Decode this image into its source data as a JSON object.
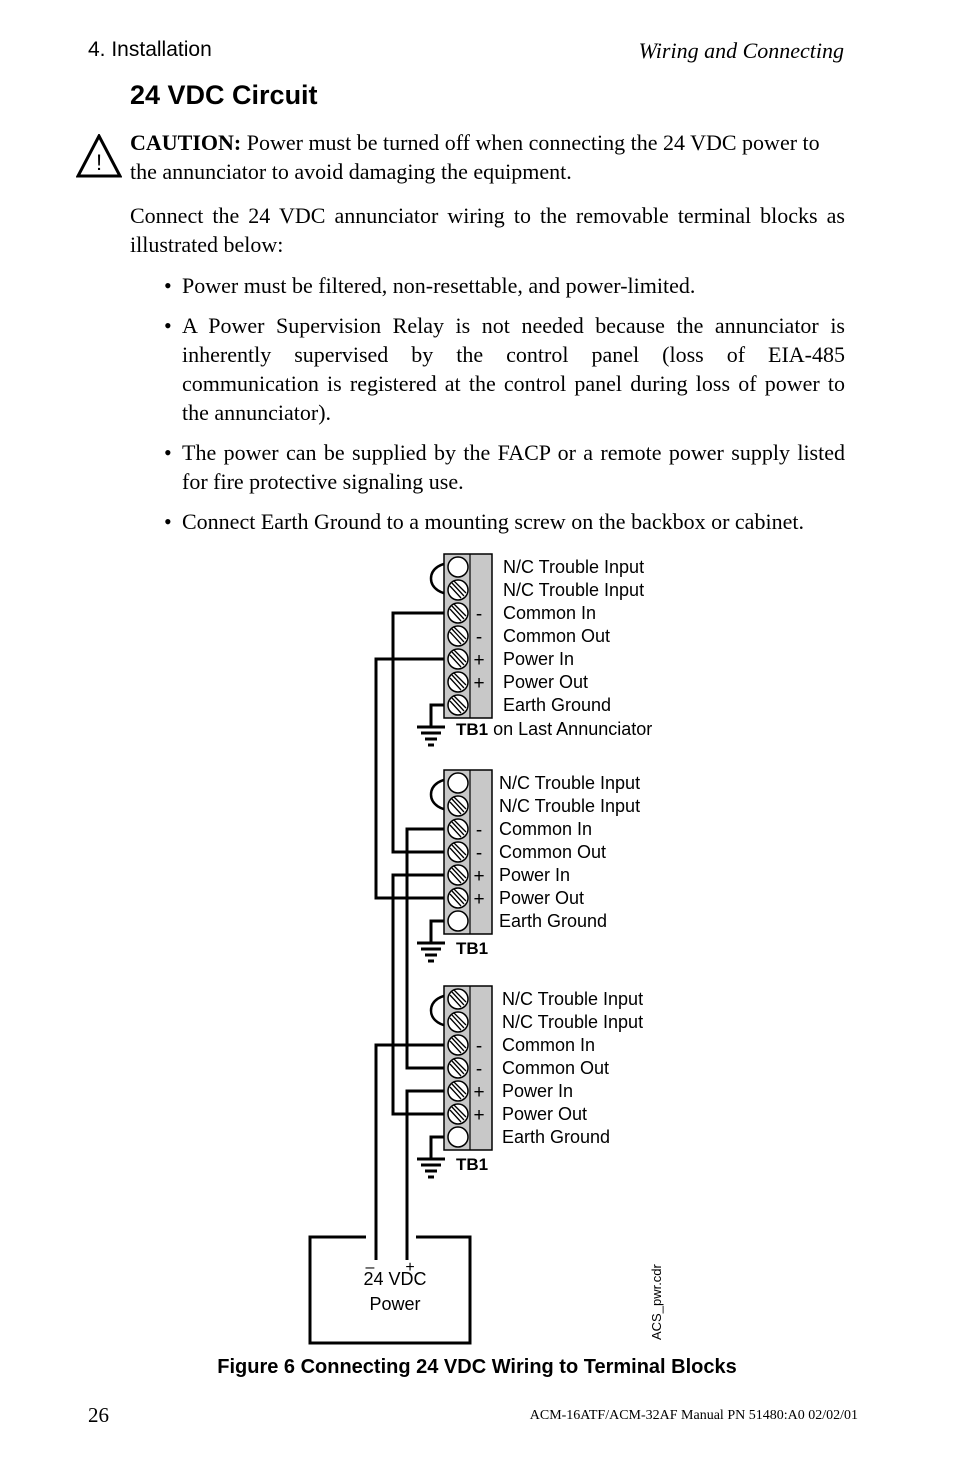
{
  "header": {
    "section": "4. Installation",
    "chapter": "Wiring and Connecting"
  },
  "title": "24 VDC Circuit",
  "caution": {
    "icon": "warning-triangle-icon",
    "label": "CAUTION:",
    "text": " Power must be turned off when connecting the 24 VDC power to the annunciator to avoid damaging the equipment."
  },
  "intro": "Connect the 24 VDC annunciator wiring to the removable terminal blocks as illustrated below:",
  "bullets": [
    "Power must be filtered, non-resettable, and power-limited.",
    "A Power Supervision Relay is not needed because the annunciator is inherently supervised by the control panel (loss of EIA-485 communication is registered at the control panel during loss of power to the annunciator).",
    "The power can be supplied by the FACP or a remote power supply listed for fire protective signaling use.",
    "Connect Earth Ground to a mounting screw on the backbox or cabinet."
  ],
  "figure": {
    "terminal_labels": [
      "N/C Trouble Input",
      "N/C Trouble Input",
      "Common In",
      "Common Out",
      "Power In",
      "Power Out",
      "Earth Ground"
    ],
    "polarity": [
      "",
      "",
      "-",
      "-",
      "+",
      "+",
      ""
    ],
    "blocks": [
      {
        "name": "TB1",
        "suffix": " on Last Annunciator"
      },
      {
        "name": "TB1",
        "suffix": ""
      },
      {
        "name": "TB1",
        "suffix": ""
      }
    ],
    "power_supply": {
      "line1": "24 VDC",
      "line2": "Power",
      "minus": "–",
      "plus": "+"
    },
    "file_ref": "ACS_pwr.cdr",
    "caption": "Figure 6  Connecting 24 VDC Wiring to Terminal Blocks"
  },
  "footer": {
    "page_number": "26",
    "doc_ref": "ACM-16ATF/ACM-32AF Manual  PN 51480:A0  02/02/01"
  }
}
